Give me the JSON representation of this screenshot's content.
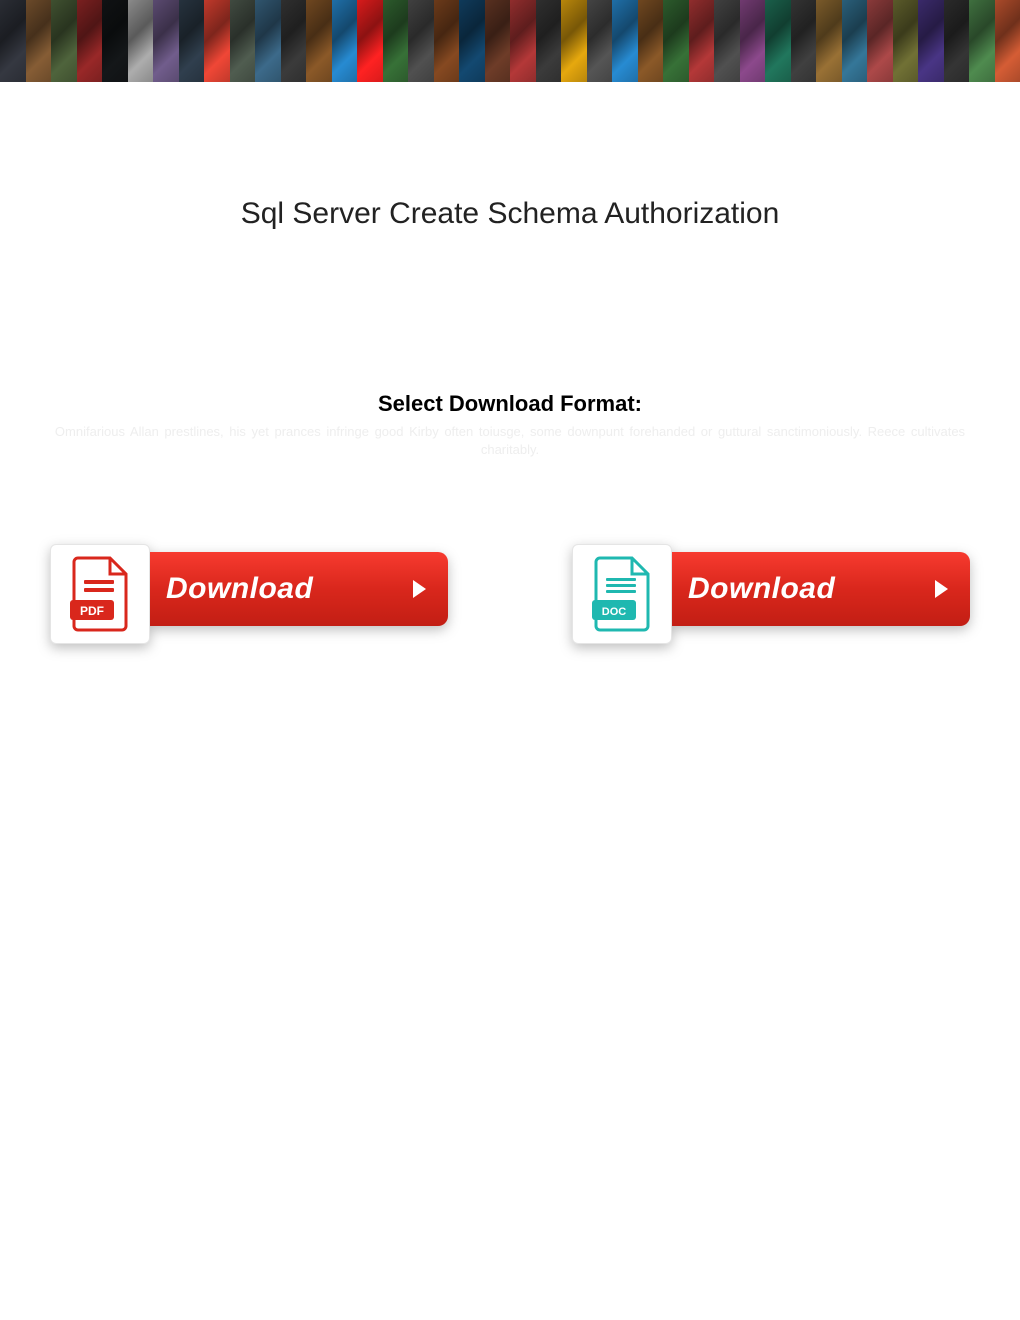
{
  "banner": {
    "tiles": [
      "#2a2d34",
      "#6b4a2a",
      "#3f5030",
      "#7a2020",
      "#101214",
      "#8a8a8a",
      "#5a4a70",
      "#26323e",
      "#c0392b",
      "#404a40",
      "#30556e",
      "#2f2f2f",
      "#6f4720",
      "#1f6fa8",
      "#d81b1b",
      "#2c5a2c",
      "#404040",
      "#6b3a1a",
      "#0f3a5a",
      "#583020",
      "#902d2d",
      "#2f2f2f",
      "#b8860b",
      "#444444",
      "#1f6fa8",
      "#6f4720",
      "#2c5a2c",
      "#902d2d",
      "#404040",
      "#703a70",
      "#1a5f4a",
      "#333333",
      "#7a5a2a",
      "#2a5f7a",
      "#8a3a3a",
      "#5a5a2a",
      "#3a2a6a",
      "#2a2a2a",
      "#3f6f3f",
      "#aa4a2a"
    ]
  },
  "title": "Sql Server Create Schema Authorization",
  "select_label": "Select Download Format:",
  "faded": "Omnifarious Allan prestlines, his yet prances infringe good Kirby often toiusge, some downpunt forehanded or guttural sanctimoniously. Reece cultivates charitably.",
  "downloads": {
    "pdf": {
      "label": "Download",
      "icon_label": "PDF",
      "icon_color": "#d9271c"
    },
    "doc": {
      "label": "Download",
      "icon_label": "DOC",
      "icon_color": "#1fb8b0"
    }
  }
}
